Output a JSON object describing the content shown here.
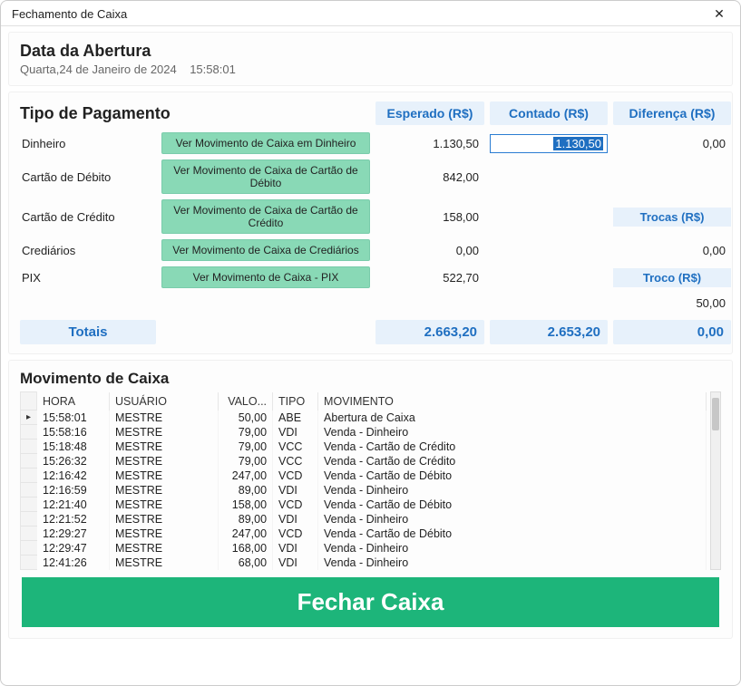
{
  "window": {
    "title": "Fechamento de Caixa",
    "close": "✕"
  },
  "opening": {
    "heading": "Data da Abertura",
    "date_text": "Quarta,24 de Janeiro de 2024",
    "time_text": "15:58:01"
  },
  "payments": {
    "section_title": "Tipo de Pagamento",
    "col_expected": "Esperado (R$)",
    "col_counted": "Contado (R$)",
    "col_diff": "Diferença (R$)",
    "rows": [
      {
        "label": "Dinheiro",
        "button": "Ver Movimento de Caixa em Dinheiro",
        "expected": "1.130,50",
        "counted_input": "1.130,50",
        "diff": "0,00"
      },
      {
        "label": "Cartão de Débito",
        "button": "Ver Movimento de Caixa de Cartão de Débito",
        "expected": "842,00"
      },
      {
        "label": "Cartão de Crédito",
        "button": "Ver Movimento de Caixa de Cartão de Crédito",
        "expected": "158,00"
      },
      {
        "label": "Crediários",
        "button": "Ver Movimento de Caixa de Crediários",
        "expected": "0,00"
      },
      {
        "label": "PIX",
        "button": "Ver Movimento de Caixa - PIX",
        "expected": "522,70"
      }
    ],
    "side": {
      "trocas_label": "Trocas (R$)",
      "trocas_value": "0,00",
      "troco_label": "Troco (R$)",
      "troco_value": "50,00"
    },
    "totals": {
      "label": "Totais",
      "expected": "2.663,20",
      "counted": "2.653,20",
      "diff": "0,00"
    }
  },
  "movements": {
    "title": "Movimento de Caixa",
    "headers": {
      "hora": "HORA",
      "usuario": "USUÁRIO",
      "valor": "VALO...",
      "tipo": "TIPO",
      "movimento": "MOVIMENTO"
    },
    "rows": [
      {
        "hora": "15:58:01",
        "usuario": "MESTRE",
        "valor": "50,00",
        "tipo": "ABE",
        "mov": "Abertura de Caixa"
      },
      {
        "hora": "15:58:16",
        "usuario": "MESTRE",
        "valor": "79,00",
        "tipo": "VDI",
        "mov": "Venda - Dinheiro"
      },
      {
        "hora": "15:18:48",
        "usuario": "MESTRE",
        "valor": "79,00",
        "tipo": "VCC",
        "mov": "Venda - Cartão de Crédito"
      },
      {
        "hora": "15:26:32",
        "usuario": "MESTRE",
        "valor": "79,00",
        "tipo": "VCC",
        "mov": "Venda - Cartão de Crédito"
      },
      {
        "hora": "12:16:42",
        "usuario": "MESTRE",
        "valor": "247,00",
        "tipo": "VCD",
        "mov": "Venda - Cartão de Débito"
      },
      {
        "hora": "12:16:59",
        "usuario": "MESTRE",
        "valor": "89,00",
        "tipo": "VDI",
        "mov": "Venda - Dinheiro"
      },
      {
        "hora": "12:21:40",
        "usuario": "MESTRE",
        "valor": "158,00",
        "tipo": "VCD",
        "mov": "Venda - Cartão de Débito"
      },
      {
        "hora": "12:21:52",
        "usuario": "MESTRE",
        "valor": "89,00",
        "tipo": "VDI",
        "mov": "Venda - Dinheiro"
      },
      {
        "hora": "12:29:27",
        "usuario": "MESTRE",
        "valor": "247,00",
        "tipo": "VCD",
        "mov": "Venda - Cartão de Débito"
      },
      {
        "hora": "12:29:47",
        "usuario": "MESTRE",
        "valor": "168,00",
        "tipo": "VDI",
        "mov": "Venda - Dinheiro"
      },
      {
        "hora": "12:41:26",
        "usuario": "MESTRE",
        "valor": "68,00",
        "tipo": "VDI",
        "mov": "Venda - Dinheiro"
      }
    ]
  },
  "close_button": "Fechar Caixa"
}
